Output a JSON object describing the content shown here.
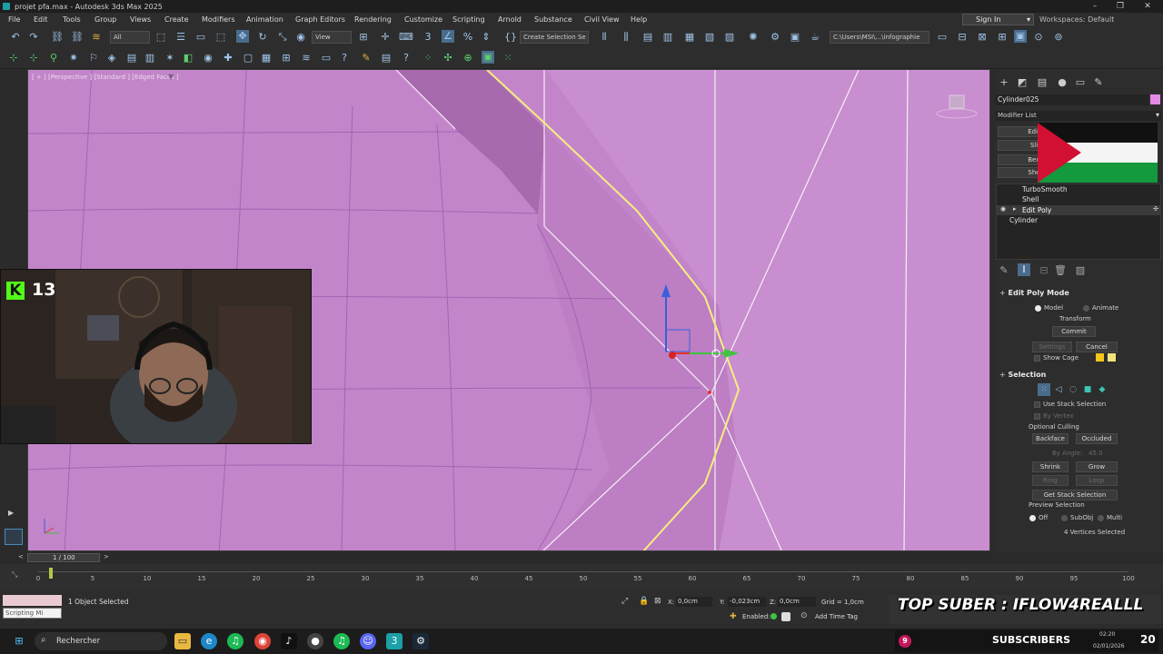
{
  "window": {
    "title": "projet pfa.max - Autodesk 3ds Max 2025"
  },
  "menu": {
    "items": [
      "File",
      "Edit",
      "Tools",
      "Group",
      "Views",
      "Create",
      "Modifiers",
      "Animation",
      "Graph Editors",
      "Rendering",
      "Customize",
      "Scripting",
      "Arnold",
      "Substance",
      "Civil View",
      "Help"
    ],
    "sign_in": "Sign In",
    "workspaces": "Workspaces: Default"
  },
  "toolbar": {
    "selection_filter": "All",
    "coord_system": "View",
    "selection_set": "Create Selection Se",
    "project_path": "C:\\Users\\MSI\\...\\infographie"
  },
  "viewport": {
    "label": "[ + ] [Perspective ] [Standard ] [Edged Faces ]",
    "filter_icon": "funnel-icon",
    "background": "#c385c9"
  },
  "webcam": {
    "badge_logo": "kick-logo",
    "badge_count": "13"
  },
  "command_panel": {
    "object_name": "Cylinder025",
    "object_color": "#e28ae6",
    "modifier_list": "Modifier List",
    "quick_buttons": [
      "Edit",
      "Sli",
      "Ben",
      "She"
    ],
    "stack": [
      "TurboSmooth",
      "Shell",
      "Edit Poly",
      "Cylinder"
    ],
    "active_stack_item": "Edit Poly",
    "edit_poly_mode": {
      "title": "Edit Poly Mode",
      "model": "Model",
      "animate": "Animate",
      "transform": "Transform",
      "commit": "Commit",
      "settings": "Settings",
      "cancel": "Cancel",
      "show_cage": "Show Cage",
      "cage_colors": [
        "#f5c518",
        "#f2e27a"
      ]
    },
    "selection": {
      "title": "Selection",
      "use_stack_selection": "Use Stack Selection",
      "by_vertex": "By Vertex",
      "optional_culling": "Optional Culling",
      "backface": "Backface",
      "occluded": "Occluded",
      "by_angle": "By Angle:",
      "by_angle_value": "45.0",
      "shrink": "Shrink",
      "grow": "Grow",
      "ring": "Ring",
      "loop": "Loop",
      "get_stack_selection": "Get Stack Selection",
      "preview_selection": "Preview Selection",
      "preview_off": "Off",
      "preview_subobj": "SubObj",
      "preview_multi": "Multi",
      "status": "4 Vertices Selected"
    }
  },
  "timeline": {
    "frame": "1 / 100",
    "ticks": [
      0,
      5,
      10,
      15,
      20,
      25,
      30,
      35,
      40,
      45,
      50,
      55,
      60,
      65,
      70,
      75,
      80,
      85,
      90,
      95,
      100
    ]
  },
  "status": {
    "selected": "1 Object Selected",
    "script_label": "Scripting Mi",
    "x_label": "X:",
    "x_value": "0,0cm",
    "y_label": "Y:",
    "y_value": "-0,023cm",
    "z_label": "Z:",
    "z_value": "0,0cm",
    "grid": "Grid = 1,0cm",
    "enabled": "Enabled:",
    "add_time_tag": "Add Time Tag"
  },
  "overlay": {
    "top_suber": "TOP SUBER : IFLOW4REALLL",
    "subscribers_count": "9",
    "subscribers_label": "SUBSCRIBERS",
    "subscribers_right": "20"
  },
  "taskbar": {
    "search_placeholder": "Rechercher",
    "time": "02:20",
    "date": "02/01/2026"
  }
}
